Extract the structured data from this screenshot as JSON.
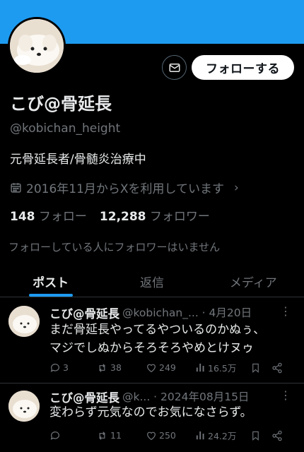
{
  "profile": {
    "display_name": "こび@骨延長",
    "handle": "@kobichan_height",
    "bio": "元骨延長者/骨髄炎治療中",
    "joined": "2016年11月からXを利用しています",
    "following_count": "148",
    "following_label": "フォロー",
    "followers_count": "12,288",
    "followers_label": "フォロワー",
    "followed_by": "フォローしている人にフォロワーはいません"
  },
  "actions": {
    "message_icon": "envelope-icon",
    "follow_label": "フォローする"
  },
  "tabs": [
    {
      "label": "ポスト",
      "active": true
    },
    {
      "label": "返信",
      "active": false
    },
    {
      "label": "メディア",
      "active": false
    }
  ],
  "tweets": [
    {
      "name": "こび@骨延長",
      "meta": "@kobichan_... · 4月20日",
      "text_line1": "まだ骨延長やってるやついるのかぬぅ、",
      "text_line2": "マジでしぬからそろそろやめとけヌゥ",
      "replies": "3",
      "reposts": "38",
      "likes": "249",
      "views": "16.5万"
    },
    {
      "name": "こび@骨延長",
      "meta": "@k... · 2024年08月15日",
      "text_line1": "変わらず元気なのでお気になさらず。",
      "replies": "",
      "reposts": "11",
      "likes": "250",
      "views": "24.2万"
    }
  ],
  "colors": {
    "banner": "#1d9bf0",
    "accent": "#1d9bf0",
    "background": "#000000",
    "text_primary": "#e7e9ea",
    "text_secondary": "#71767b"
  }
}
